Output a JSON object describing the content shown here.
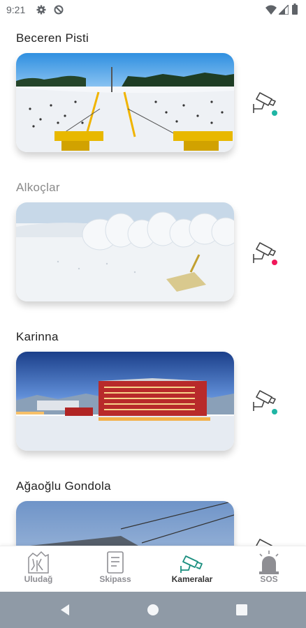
{
  "status_bar": {
    "time": "9:21",
    "icons": [
      "gear-icon",
      "data-saver-icon",
      "wifi-icon",
      "signal-icon",
      "battery-icon"
    ]
  },
  "cameras": [
    {
      "title": "Beceren Pisti",
      "status": "online"
    },
    {
      "title": "Alkoçlar",
      "status": "offline"
    },
    {
      "title": "Karinna",
      "status": "online"
    },
    {
      "title": "Ağaoğlu Gondola",
      "status": "online"
    }
  ],
  "bottom_nav": {
    "items": [
      {
        "label": "Uludağ",
        "icon": "uludag-icon"
      },
      {
        "label": "Skipass",
        "icon": "skipass-icon"
      },
      {
        "label": "Kameralar",
        "icon": "camera-icon",
        "active": true
      },
      {
        "label": "SOS",
        "icon": "siren-icon"
      }
    ]
  },
  "colors": {
    "online": "#1fb5a4",
    "offline": "#f0175a",
    "accent": "#1b8f7f",
    "inactive": "#8e8e93"
  }
}
